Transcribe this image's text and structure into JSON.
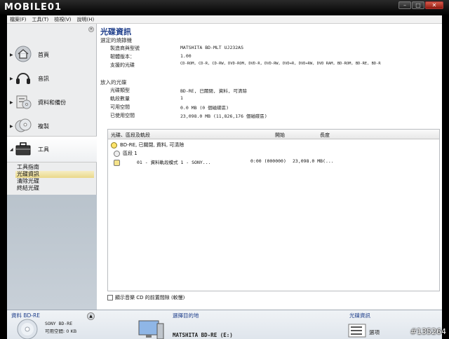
{
  "window": {
    "logo": "MOBILE01",
    "btn_min": "–",
    "btn_max": "□",
    "btn_close": "✕"
  },
  "menu": [
    "檔案(F)",
    "工具(T)",
    "檢視(V)",
    "說明(H)"
  ],
  "sidebar": {
    "collapse": "«",
    "items": [
      {
        "label": "首頁",
        "icon": "home-icon"
      },
      {
        "label": "音訊",
        "icon": "headphones-icon"
      },
      {
        "label": "資料和備份",
        "icon": "data-backup-icon"
      },
      {
        "label": "複製",
        "icon": "copy-disc-icon"
      },
      {
        "label": "工具",
        "icon": "toolbox-icon"
      }
    ],
    "subitems": [
      "工具指南",
      "光碟資訊",
      "清除光碟",
      "終結光碟"
    ],
    "selected_subitem": 1
  },
  "main": {
    "title": "光碟資訊",
    "recorder_header": "選定的燒錄機",
    "recorder": [
      {
        "k": "製造商與型號",
        "v": "MATSHITA BD-MLT UJ232AS"
      },
      {
        "k": "韌體版本：",
        "v": "1.00"
      },
      {
        "k": "支援的光碟",
        "v": "CD-ROM, CD-R, CD-RW, DVD-ROM, DVD-R, DVD-RW, DVD+R, DVD+RW, DVD RAM, BD-ROM, BD-RE, BD-R"
      }
    ],
    "disc_header": "放入的光碟",
    "disc": [
      {
        "k": "光碟類型",
        "v": "BD-RE, 已關閉, 資料, 可清除"
      },
      {
        "k": "軌段數量",
        "v": "1"
      },
      {
        "k": "可用空間",
        "v": "0.0 MB (0 個磁碟區)"
      },
      {
        "k": "已使用空間",
        "v": "23,098.0 MB (11,826,176 個磁碟區)"
      }
    ],
    "table": {
      "headers": [
        "光碟、區段及軌段",
        "開始",
        "長度"
      ],
      "rows": [
        {
          "text": "BD-RE, 已關閉, 資料, 可清除",
          "icon": "disc-icon"
        },
        {
          "text": "區段 1",
          "icon": "session-icon"
        },
        {
          "text": "01 - 資料軌段模式 1 - SONY...",
          "start": "0:00 (000000)",
          "length": "23,098.0 MB(...",
          "icon": "track-icon"
        }
      ]
    },
    "checkbox_label": "顯示音樂 CD 的前置間隙 (較慢)"
  },
  "bottom": {
    "source_label": "資料 BD-RE",
    "disc_name": "SONY BD-RE",
    "free_space": "可用空間: 0 KB",
    "eject": "▲",
    "target_label": "選擇目的地",
    "target_drive": "MATSHITA BD-RE (E:)",
    "info_label": "光碟資訊",
    "options": "選項"
  },
  "watermark": "#135264"
}
